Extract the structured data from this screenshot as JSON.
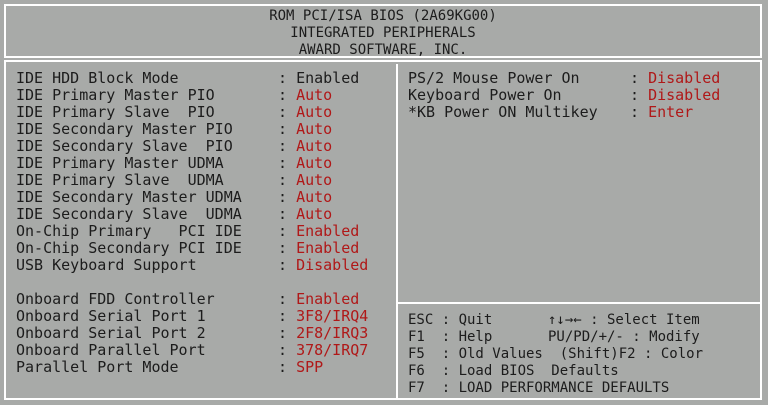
{
  "header": {
    "line1": "ROM PCI/ISA BIOS (2A69KG00)",
    "line2": "INTEGRATED PERIPHERALS",
    "line3": "AWARD SOFTWARE, INC."
  },
  "left_items": [
    {
      "label": "IDE HDD Block Mode",
      "value": "Enabled",
      "highlight": false
    },
    {
      "label": "IDE Primary Master PIO",
      "value": "Auto",
      "highlight": true
    },
    {
      "label": "IDE Primary Slave  PIO",
      "value": "Auto",
      "highlight": true
    },
    {
      "label": "IDE Secondary Master PIO",
      "value": "Auto",
      "highlight": true
    },
    {
      "label": "IDE Secondary Slave  PIO",
      "value": "Auto",
      "highlight": true
    },
    {
      "label": "IDE Primary Master UDMA",
      "value": "Auto",
      "highlight": true
    },
    {
      "label": "IDE Primary Slave  UDMA",
      "value": "Auto",
      "highlight": true
    },
    {
      "label": "IDE Secondary Master UDMA",
      "value": "Auto",
      "highlight": true
    },
    {
      "label": "IDE Secondary Slave  UDMA",
      "value": "Auto",
      "highlight": true
    },
    {
      "label": "On-Chip Primary   PCI IDE",
      "value": "Enabled",
      "highlight": true
    },
    {
      "label": "On-Chip Secondary PCI IDE",
      "value": "Enabled",
      "highlight": true
    },
    {
      "label": "USB Keyboard Support",
      "value": "Disabled",
      "highlight": true
    },
    {
      "label": "",
      "value": "",
      "highlight": false
    },
    {
      "label": "Onboard FDD Controller",
      "value": "Enabled",
      "highlight": true
    },
    {
      "label": "Onboard Serial Port 1",
      "value": "3F8/IRQ4",
      "highlight": true
    },
    {
      "label": "Onboard Serial Port 2",
      "value": "2F8/IRQ3",
      "highlight": true
    },
    {
      "label": "Onboard Parallel Port",
      "value": "378/IRQ7",
      "highlight": true
    },
    {
      "label": "Parallel Port Mode",
      "value": "SPP",
      "highlight": true
    }
  ],
  "right_items": [
    {
      "label": "PS/2 Mouse Power On",
      "value": "Disabled"
    },
    {
      "label": "Keyboard Power On",
      "value": "Disabled"
    },
    {
      "label": "*KB Power ON Multikey",
      "value": "Enter"
    }
  ],
  "help": {
    "line1_left": "ESC : Quit",
    "line1_right": "↑↓→← : Select Item",
    "line2_left": "F1  : Help",
    "line2_right": "PU/PD/+/- : Modify",
    "line3": "F5  : Old Values  (Shift)F2 : Color",
    "line4": "F6  : Load BIOS  Defaults",
    "line5": "F7  : LOAD PERFORMANCE DEFAULTS"
  },
  "colors": {
    "background": "#a8aaa8",
    "text": "#1c1c1c",
    "value_highlight": "#b01818",
    "border": "#ffffff"
  }
}
